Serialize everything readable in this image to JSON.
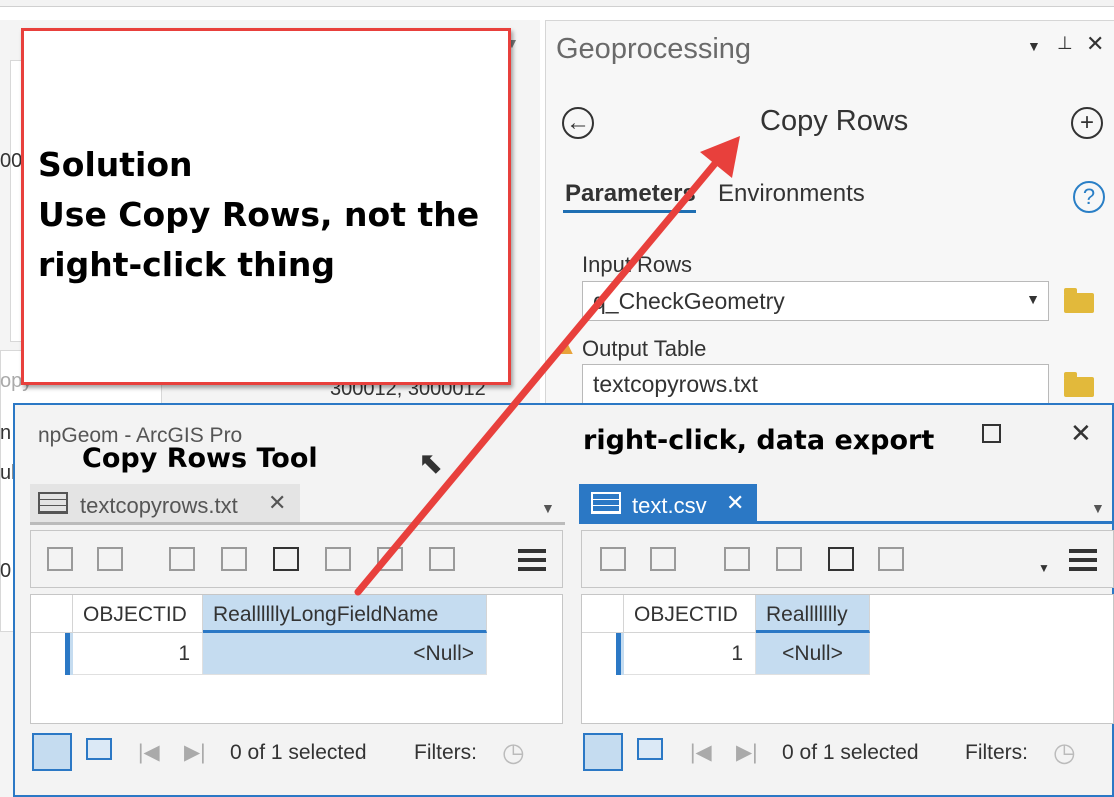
{
  "background": {
    "left_fragments": [
      "00",
      "opy",
      "n",
      "ul",
      "0"
    ],
    "coord_text": "300012, 3000012"
  },
  "geoprocessing": {
    "title": "Geoprocessing",
    "tool_title": "Copy Rows",
    "tabs": [
      "Parameters",
      "Environments"
    ],
    "help_label": "?",
    "input_rows_label": "Input Rows",
    "input_rows_value": "q_CheckGeometry",
    "output_table_label": "Output Table",
    "output_table_value": "textcopyrows.txt"
  },
  "callout": {
    "lines": [
      "Solution",
      "Use Copy Rows, not the",
      "right-click thing"
    ],
    "color": "#e8403c"
  },
  "table_window": {
    "title": "npGeom - ArcGIS Pro",
    "annotation_left": "Copy Rows Tool",
    "annotation_right": "right-click, data export",
    "left_table": {
      "tab_label": "textcopyrows.txt",
      "columns": [
        "OBJECTID",
        "ReallllllyLongFieldName"
      ],
      "row": [
        "1",
        "<Null>"
      ],
      "status": "0 of 1 selected",
      "filters_label": "Filters:"
    },
    "right_table": {
      "tab_label": "text.csv",
      "columns": [
        "OBJECTID",
        "Reallllllly"
      ],
      "row": [
        "1",
        "<Null>"
      ],
      "status": "0 of 1 selected",
      "filters_label": "Filters:"
    }
  },
  "colors": {
    "accent": "#2b78c5",
    "arrow": "#e8403c",
    "selection": "#c5dcf0"
  }
}
